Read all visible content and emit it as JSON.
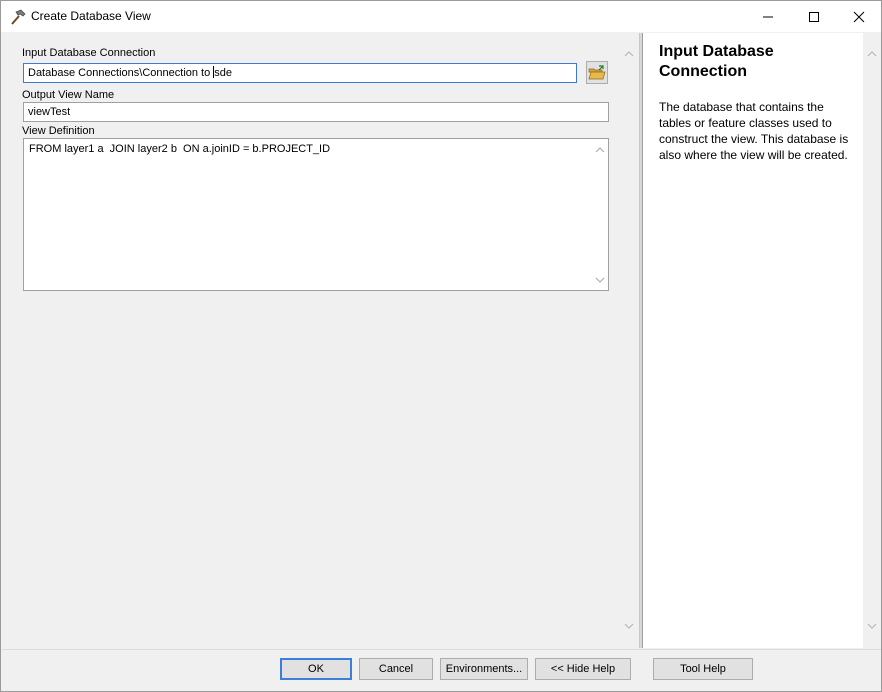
{
  "window": {
    "title": "Create Database View",
    "controls": {
      "minimize": "minimize",
      "maximize": "maximize",
      "close": "close"
    }
  },
  "params": {
    "input_connection": {
      "label": "Input Database Connection",
      "value_before_caret": "Database Connections\\Connection to ",
      "value_after_caret": "sde"
    },
    "output_view_name": {
      "label": "Output View Name",
      "value": "viewTest"
    },
    "view_definition": {
      "label": "View Definition",
      "value": "FROM layer1 a  JOIN layer2 b  ON a.joinID = b.PROJECT_ID"
    }
  },
  "help": {
    "title": "Input Database Connection",
    "body": "The database that contains the tables or feature classes used to construct the view. This database is also where the view will be created."
  },
  "buttons": {
    "ok": "OK",
    "cancel": "Cancel",
    "environments": "Environments...",
    "hide_help": "<< Hide Help",
    "tool_help": "Tool Help"
  },
  "colors": {
    "focus_border": "#3b7bd8",
    "folder_icon": "#e8b94a"
  }
}
